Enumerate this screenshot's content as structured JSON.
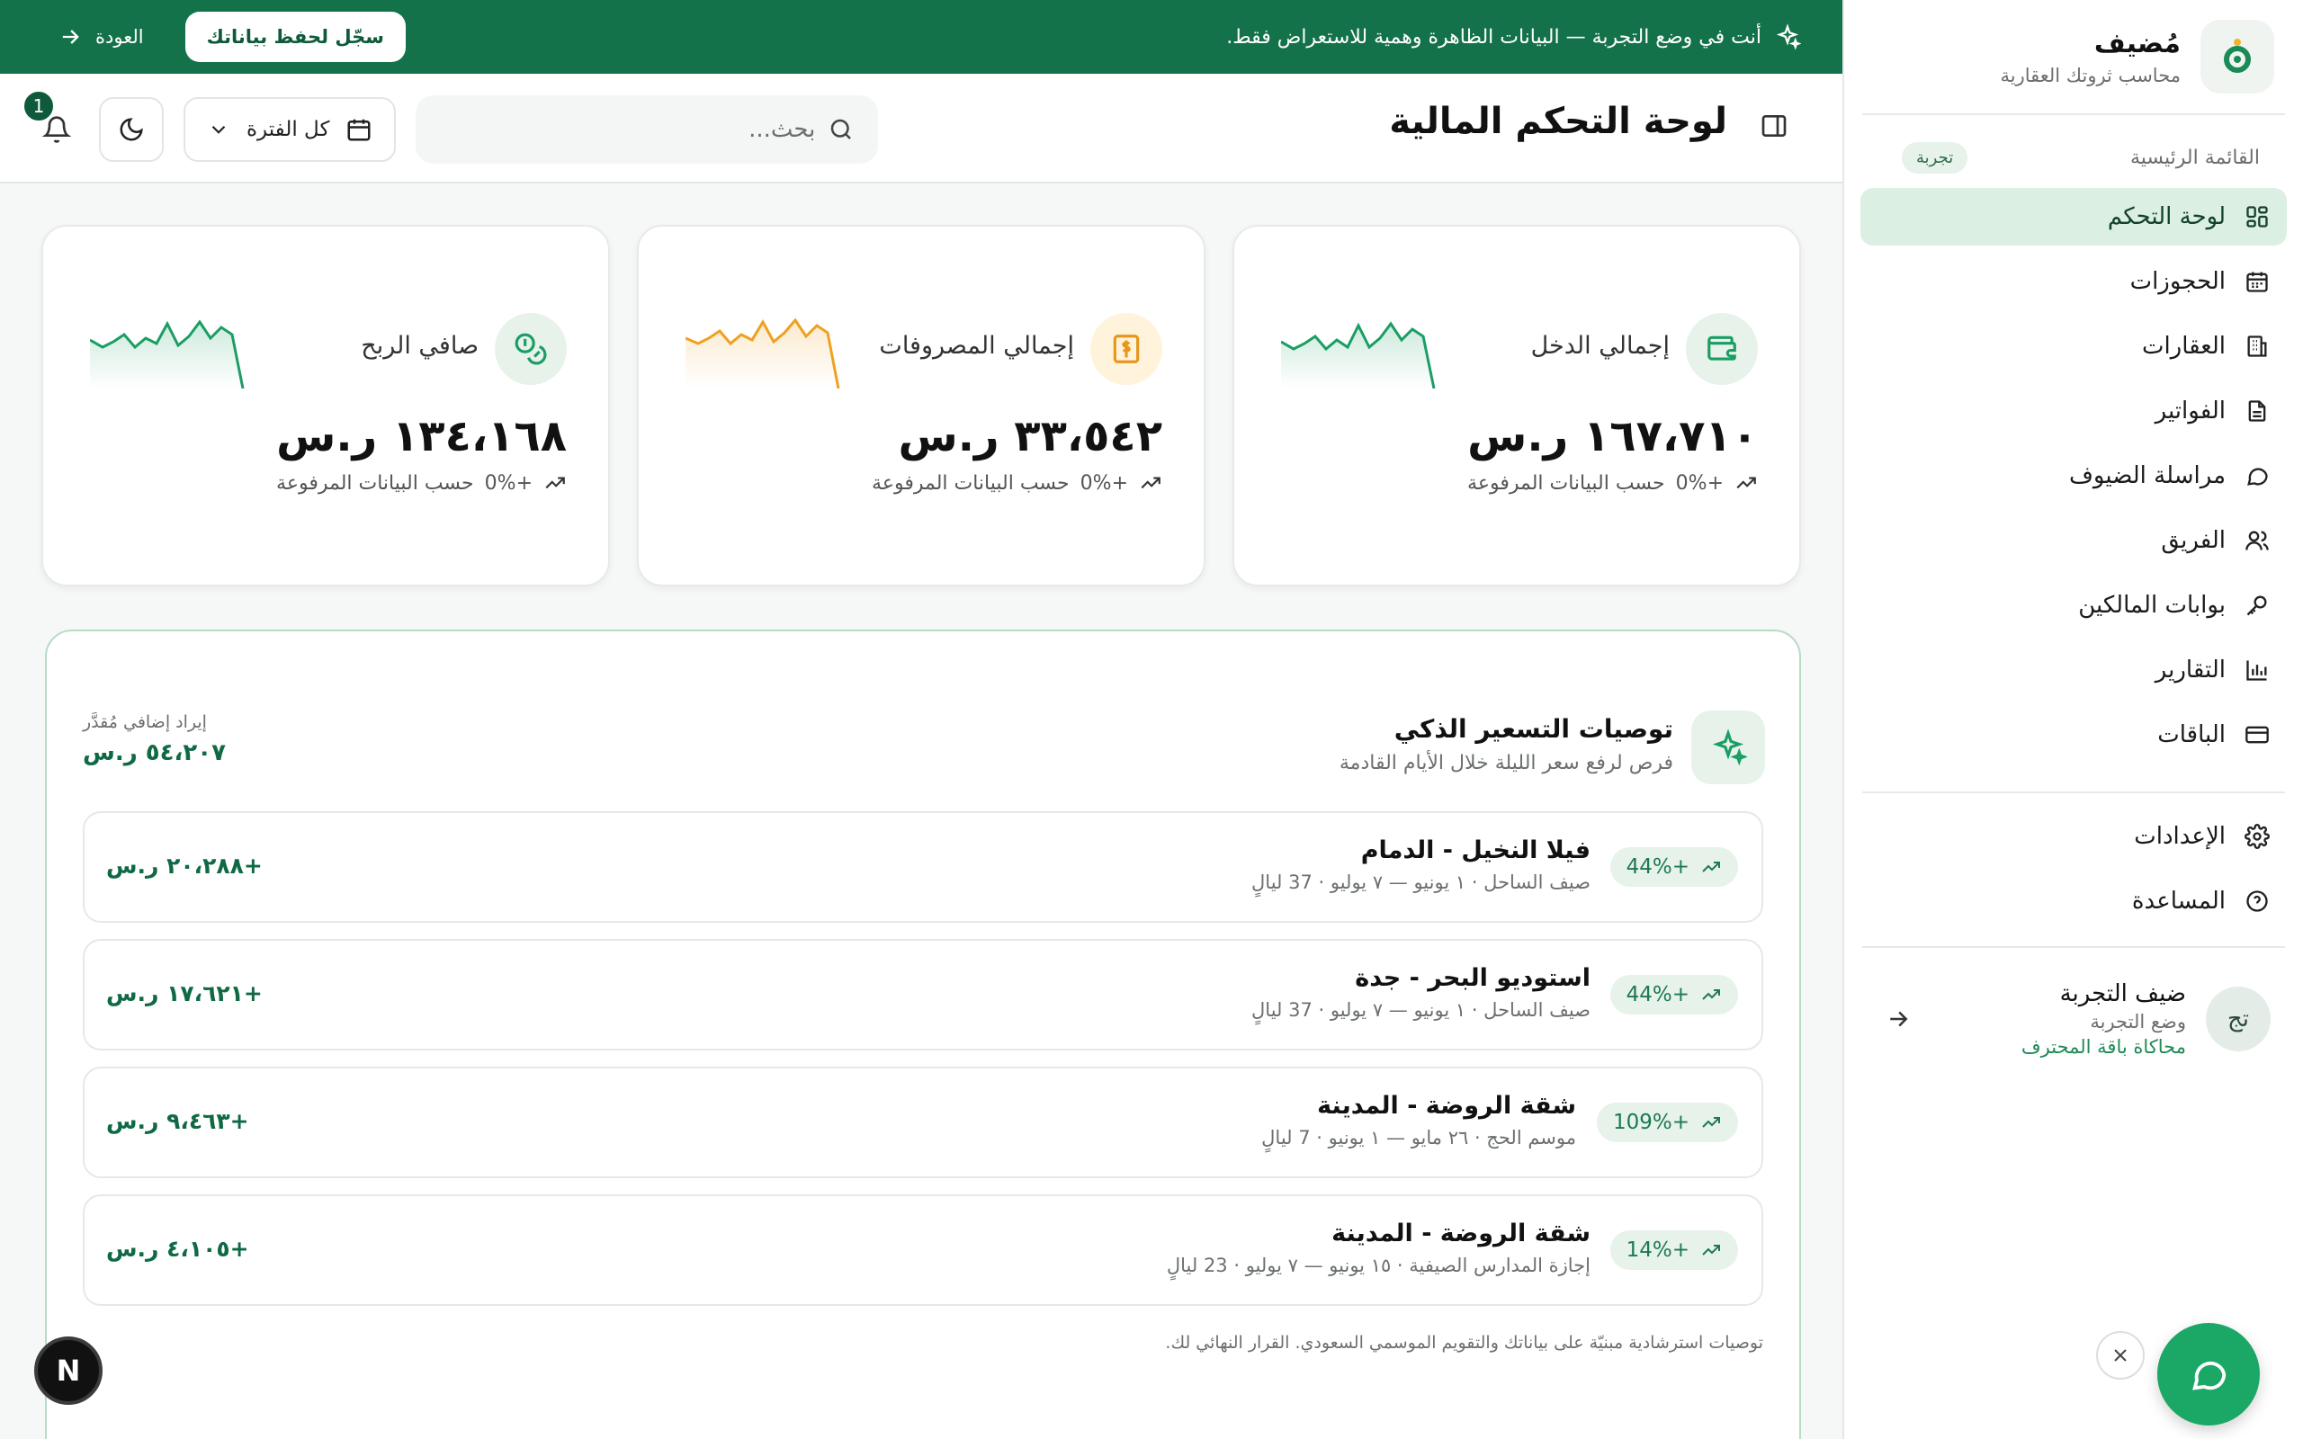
{
  "brand": {
    "name": "مُضيف",
    "subtitle": "محاسب ثروتك العقارية"
  },
  "sidebar": {
    "section_label": "القائمة الرئيسية",
    "trial_badge": "تجربة",
    "items": [
      {
        "label": "لوحة التحكم",
        "icon": "dashboard-icon",
        "active": true
      },
      {
        "label": "الحجوزات",
        "icon": "calendar-icon"
      },
      {
        "label": "العقارات",
        "icon": "building-icon"
      },
      {
        "label": "الفواتير",
        "icon": "document-icon"
      },
      {
        "label": "مراسلة الضيوف",
        "icon": "chat-bubble-icon"
      },
      {
        "label": "الفريق",
        "icon": "users-icon"
      },
      {
        "label": "بوابات المالكين",
        "icon": "key-icon"
      },
      {
        "label": "التقارير",
        "icon": "bar-chart-icon"
      },
      {
        "label": "الباقات",
        "icon": "credit-card-icon"
      }
    ],
    "secondary": [
      {
        "label": "الإعدادات",
        "icon": "gear-icon"
      },
      {
        "label": "المساعدة",
        "icon": "help-circle-icon"
      }
    ],
    "user": {
      "initials": "تج",
      "name": "ضيف التجربة",
      "role": "وضع التجربة",
      "plan": "محاكاة باقة المحترف"
    }
  },
  "banner": {
    "message": "أنت في وضع التجربة — البيانات الظاهرة وهمية للاستعراض فقط.",
    "signup_label": "سجّل لحفظ بياناتك",
    "back_label": "العودة"
  },
  "header": {
    "title": "لوحة التحكم المالية",
    "search_placeholder": "بحث...",
    "period_label": "كل الفترة",
    "notification_count": "1"
  },
  "stats": [
    {
      "label": "إجمالي الدخل",
      "value": "١٦٧،٧١٠ ر.س",
      "change": "+0%",
      "note": "حسب البيانات المرفوعة",
      "color": "#1a9e63",
      "icon": "wallet-icon"
    },
    {
      "label": "إجمالي المصروفات",
      "value": "٣٣،٥٤٢ ر.س",
      "change": "+0%",
      "note": "حسب البيانات المرفوعة",
      "color": "#f0a020",
      "icon": "receipt-icon"
    },
    {
      "label": "صافي الربح",
      "value": "١٣٤،١٦٨ ر.س",
      "change": "+0%",
      "note": "حسب البيانات المرفوعة",
      "color": "#1a9e63",
      "icon": "coins-icon"
    }
  ],
  "pricing": {
    "title": "توصيات التسعير الذكي",
    "subtitle": "فرص لرفع سعر الليلة خلال الأيام القادمة",
    "estimate_label": "إيراد إضافي مُقدَّر",
    "estimate_value": "٥٤،٢٠٧ ر.س",
    "items": [
      {
        "title": "فيلا النخيل - الدمام",
        "detail": "صيف الساحل · ١ يونيو — ٧ يوليو · 37 ليالٍ",
        "uplift": "+44%",
        "gain": "+٢٠،٢٨٨ ر.س"
      },
      {
        "title": "استوديو البحر - جدة",
        "detail": "صيف الساحل · ١ يونيو — ٧ يوليو · 37 ليالٍ",
        "uplift": "+44%",
        "gain": "+١٧،٦٢١ ر.س"
      },
      {
        "title": "شقة الروضة - المدينة",
        "detail": "موسم الحج · ٢٦ مايو — ١ يونيو · 7 ليالٍ",
        "uplift": "+109%",
        "gain": "+٩،٤٦٣ ر.س"
      },
      {
        "title": "شقة الروضة - المدينة",
        "detail": "إجازة المدارس الصيفية · ١٥ يونيو — ٧ يوليو · 23 ليالٍ",
        "uplift": "+14%",
        "gain": "+٤،١٠٥ ر.س"
      }
    ],
    "note": "توصيات استرشادية مبنيّة على بياناتك والتقويم الموسمي السعودي. القرار النهائي لك."
  },
  "floating": {
    "dev_badge": "N"
  },
  "colors": {
    "primary": "#14724b",
    "accent": "#1a9e63",
    "warning": "#f0a020"
  }
}
